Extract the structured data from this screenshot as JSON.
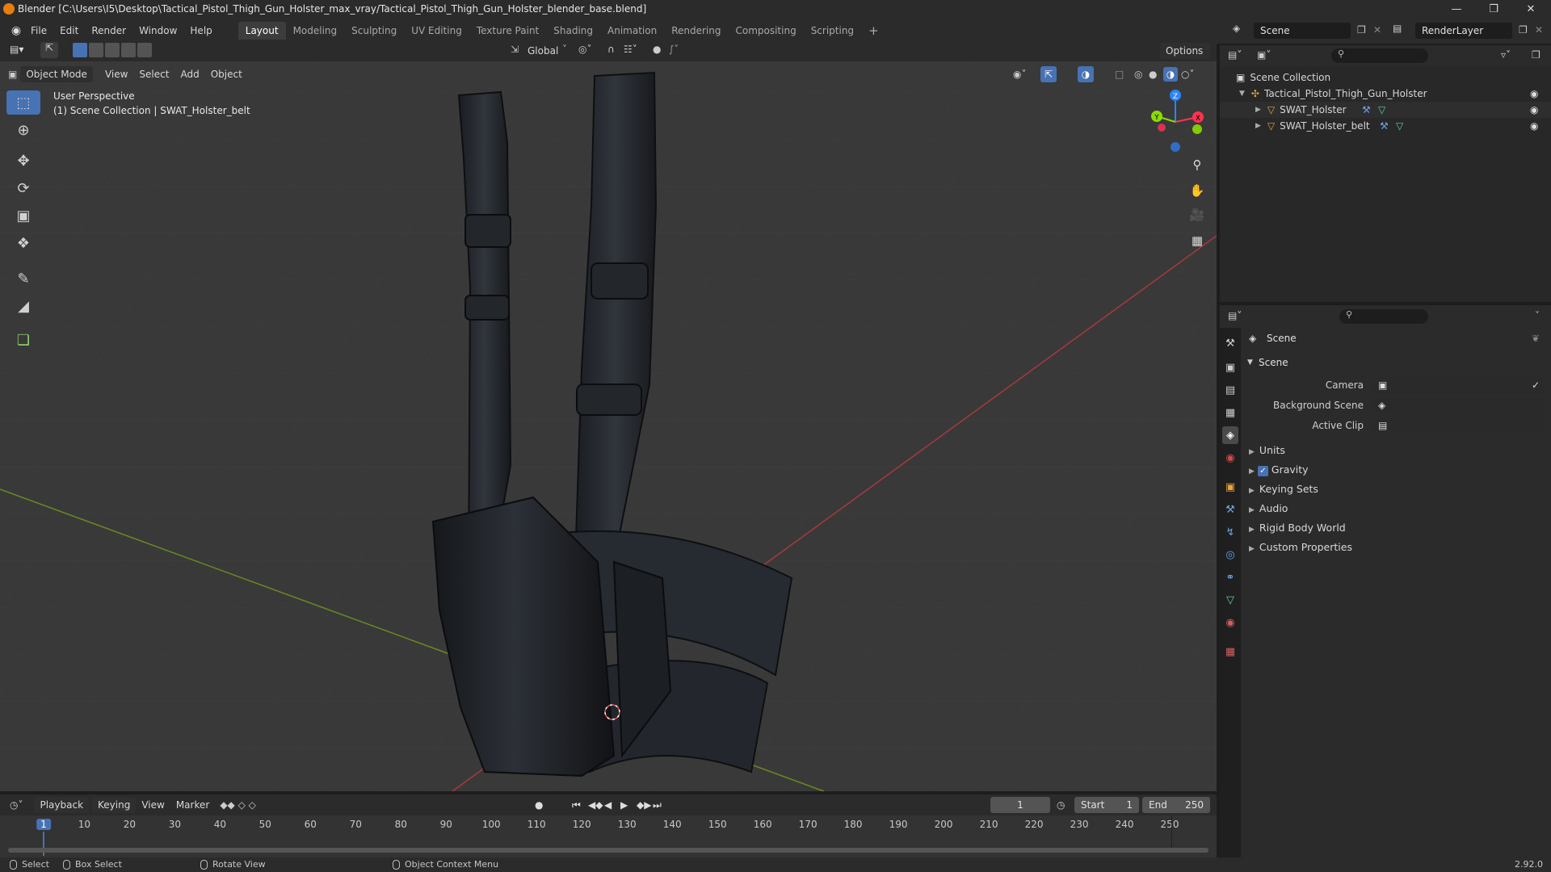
{
  "titlebar": {
    "title": "Blender [C:\\Users\\I5\\Desktop\\Tactical_Pistol_Thigh_Gun_Holster_max_vray/Tactical_Pistol_Thigh_Gun_Holster_blender_base.blend]"
  },
  "menus": [
    "File",
    "Edit",
    "Render",
    "Window",
    "Help"
  ],
  "workspaces": [
    "Layout",
    "Modeling",
    "Sculpting",
    "UV Editing",
    "Texture Paint",
    "Shading",
    "Animation",
    "Rendering",
    "Compositing",
    "Scripting"
  ],
  "scene_selector": {
    "value": "Scene"
  },
  "renderlayer_selector": {
    "value": "RenderLayer"
  },
  "toolbar": {
    "transform_orientation": "Global",
    "options": "Options"
  },
  "viewport_header": {
    "mode": "Object Mode",
    "view": "View",
    "select": "Select",
    "add": "Add",
    "object": "Object"
  },
  "viewport": {
    "overlay_line1": "User Perspective",
    "overlay_line2": "(1) Scene Collection | SWAT_Holster_belt",
    "gizmo": {
      "x": "X",
      "y": "Y",
      "z": "Z"
    }
  },
  "outliner": {
    "root": "Scene Collection",
    "collection": "Tactical_Pistol_Thigh_Gun_Holster",
    "objects": [
      "SWAT_Holster",
      "SWAT_Holster_belt"
    ]
  },
  "properties": {
    "context": "Scene",
    "panel": "Scene",
    "camera_label": "Camera",
    "bg_scene_label": "Background Scene",
    "active_clip_label": "Active Clip",
    "sections": [
      "Units",
      "Gravity",
      "Keying Sets",
      "Audio",
      "Rigid Body World",
      "Custom Properties"
    ]
  },
  "timeline": {
    "playback": "Playback",
    "keying": "Keying",
    "view": "View",
    "marker": "Marker",
    "current_frame": "1",
    "start_label": "Start",
    "start": "1",
    "end_label": "End",
    "end": "250",
    "ticks": [
      "1",
      "10",
      "20",
      "30",
      "40",
      "50",
      "60",
      "70",
      "80",
      "90",
      "100",
      "110",
      "120",
      "130",
      "140",
      "150",
      "160",
      "170",
      "180",
      "190",
      "200",
      "210",
      "220",
      "230",
      "240",
      "250"
    ]
  },
  "statusbar": {
    "select": "Select",
    "box_select": "Box Select",
    "rotate_view": "Rotate View",
    "context_menu": "Object Context Menu",
    "version": "2.92.0"
  },
  "colors": {
    "accent": "#4772b3",
    "x_axis": "#ff3352",
    "y_axis": "#8bdc00",
    "z_axis": "#2b85ff"
  }
}
